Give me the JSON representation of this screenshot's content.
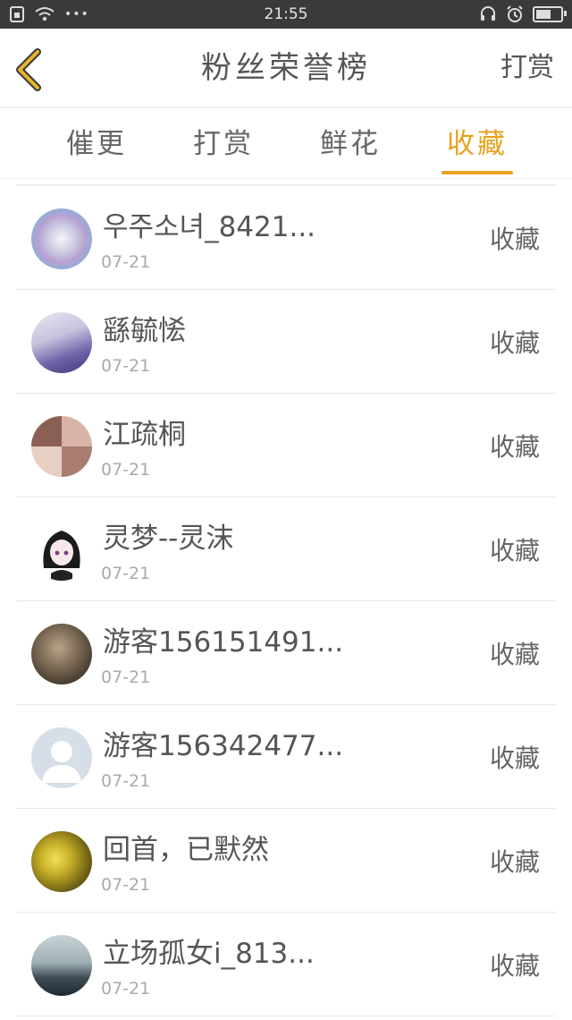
{
  "status_bar": {
    "time": "21:55",
    "dots": "•••"
  },
  "header": {
    "title": "粉丝荣誉榜",
    "right_button": "打赏"
  },
  "tabs": [
    {
      "label": "催更"
    },
    {
      "label": "打赏"
    },
    {
      "label": "鲜花"
    },
    {
      "label": "收藏",
      "active": true
    }
  ],
  "rows": [
    {
      "name": "우주소녀_8421...",
      "date": "07-21",
      "action": "收藏"
    },
    {
      "name": "繇毓恡",
      "date": "07-21",
      "action": "收藏"
    },
    {
      "name": "江疏桐",
      "date": "07-21",
      "action": "收藏"
    },
    {
      "name": "灵梦--灵沫",
      "date": "07-21",
      "action": "收藏"
    },
    {
      "name": "游客156151491...",
      "date": "07-21",
      "action": "收藏"
    },
    {
      "name": "游客156342477...",
      "date": "07-21",
      "action": "收藏"
    },
    {
      "name": "回首，已默然",
      "date": "07-21",
      "action": "收藏"
    },
    {
      "name": "立场孤女i_813...",
      "date": "07-21",
      "action": "收藏"
    }
  ],
  "colors": {
    "accent": "#e8a21c",
    "status_bar": "#3a3a3a"
  }
}
